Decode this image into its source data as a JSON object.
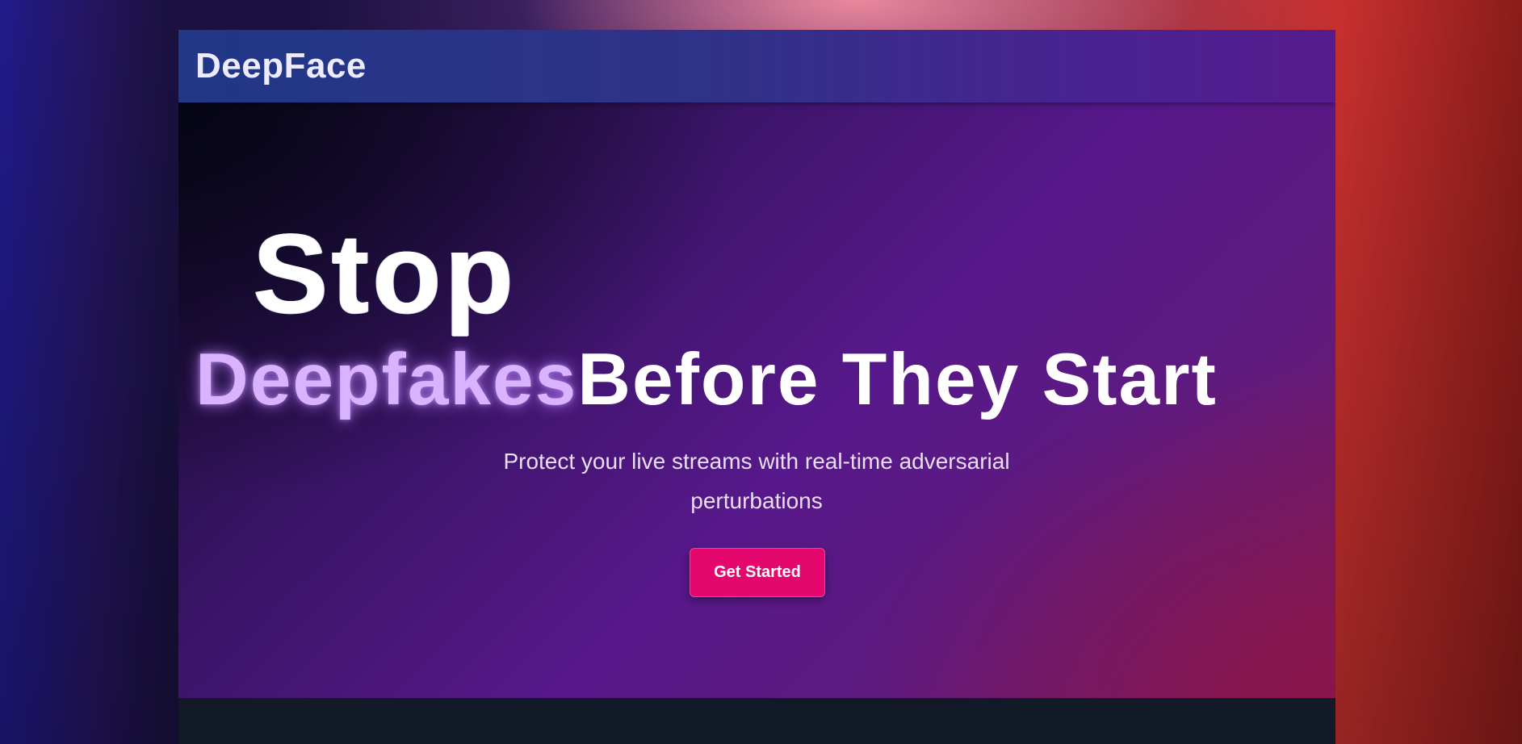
{
  "app": {
    "brand": "DeepFace"
  },
  "hero": {
    "line1": "Stop",
    "headline_highlight": "Deepfakes",
    "headline_rest": "Before They Start",
    "subtitle": "Protect your live streams with real-time adversarial perturbations",
    "cta_label": "Get Started"
  },
  "colors": {
    "accent": "#e4086e",
    "highlight_text": "#d9b3ff",
    "navbar_start": "#213787",
    "navbar_end": "#561c8e",
    "footer": "#121a28"
  }
}
